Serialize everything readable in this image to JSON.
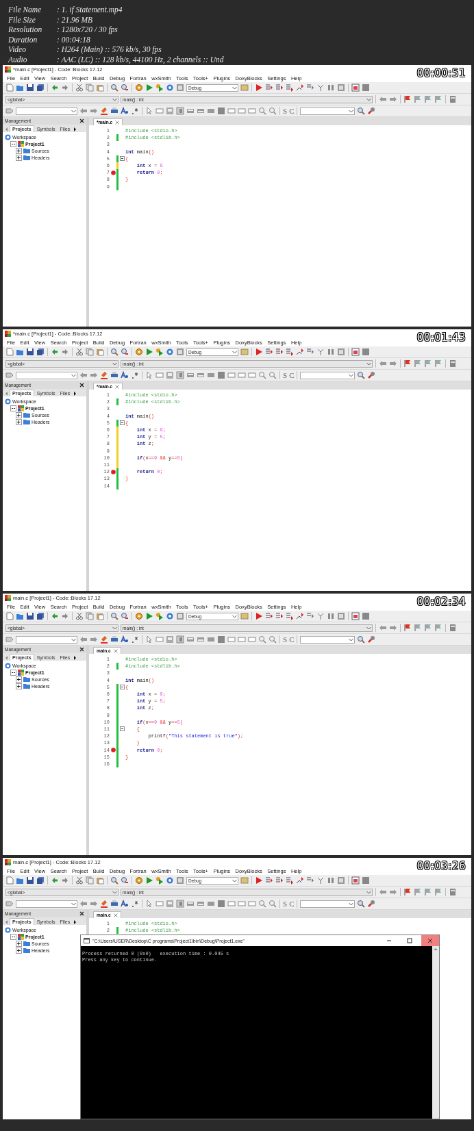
{
  "header": {
    "fields": [
      {
        "label": "File Name",
        "value": ":  1. if Statement.mp4"
      },
      {
        "label": "File Size",
        "value": ":  21.96 MB"
      },
      {
        "label": "Resolution",
        "value": ":  1280x720 / 30 fps"
      },
      {
        "label": "Duration",
        "value": ":  00:04:18"
      },
      {
        "label": "Video",
        "value": ":  H264 (Main) :: 576 kb/s, 30 fps"
      },
      {
        "label": "Audio",
        "value": ":  AAC (LC) :: 128 kb/s, 44100 Hz, 2 channels :: Und"
      }
    ]
  },
  "frames": [
    {
      "title": "*main.c [Project1] - Code::Blocks 17.12",
      "timestamp": "00:00:51",
      "menu": [
        "File",
        "Edit",
        "View",
        "Search",
        "Project",
        "Build",
        "Debug",
        "Fortran",
        "wxSmith",
        "Tools",
        "Tools+",
        "Plugins",
        "DoxyBlocks",
        "Settings",
        "Help"
      ],
      "build_target": "Debug",
      "scope_combo": "<global>",
      "function_combo": "main() : int",
      "toolbar_letters": [
        "S",
        "C"
      ],
      "management": {
        "title": "Management",
        "tabs": [
          {
            "label": "Projects",
            "selected": true
          },
          {
            "label": "Symbols",
            "selected": false
          },
          {
            "label": "Files",
            "selected": false
          }
        ],
        "tree": [
          {
            "label": "Workspace",
            "kind": "workspace",
            "children": [
              {
                "label": "Project1",
                "kind": "project",
                "expanded": true,
                "children": [
                  {
                    "label": "Sources",
                    "kind": "folder",
                    "expanded": false
                  },
                  {
                    "label": "Headers",
                    "kind": "folder",
                    "expanded": false
                  }
                ]
              }
            ]
          }
        ]
      },
      "editor_tab": "*main.c",
      "lines": [
        {
          "number": "1",
          "saved": false,
          "unsaved": false,
          "breakpoint": false,
          "fold": false,
          "tokens": [
            {
              "text": "#include <stdio.h>",
              "kind": "pre"
            }
          ]
        },
        {
          "number": "2",
          "saved": true,
          "unsaved": false,
          "breakpoint": false,
          "fold": false,
          "tokens": [
            {
              "text": "#include <stdlib.h>",
              "kind": "pre"
            }
          ]
        },
        {
          "number": "3",
          "saved": false,
          "unsaved": false,
          "breakpoint": false,
          "fold": false
        },
        {
          "number": "4",
          "saved": false,
          "unsaved": false,
          "breakpoint": false,
          "fold": false,
          "tokens": [
            {
              "text": "int",
              "kind": "kw"
            },
            {
              "text": " main",
              "kind": "plain"
            },
            {
              "text": "()",
              "kind": "op"
            }
          ]
        },
        {
          "number": "5",
          "saved": true,
          "unsaved": false,
          "breakpoint": false,
          "fold": true,
          "tokens": [
            {
              "text": "{",
              "kind": "op"
            }
          ]
        },
        {
          "number": "6",
          "saved": false,
          "unsaved": true,
          "breakpoint": false,
          "fold": false,
          "tokens": [
            {
              "text": "    int",
              "kind": "kw"
            },
            {
              "text": " x ",
              "kind": "plain"
            },
            {
              "text": "=",
              "kind": "op"
            },
            {
              "text": " 9",
              "kind": "num"
            }
          ]
        },
        {
          "number": "7",
          "saved": true,
          "unsaved": false,
          "breakpoint": true,
          "fold": false,
          "tokens": [
            {
              "text": "    return",
              "kind": "kw"
            },
            {
              "text": " 0",
              "kind": "num"
            },
            {
              "text": ";",
              "kind": "op"
            }
          ]
        },
        {
          "number": "8",
          "saved": true,
          "unsaved": false,
          "breakpoint": false,
          "fold": false,
          "tokens": [
            {
              "text": "}",
              "kind": "op"
            }
          ]
        },
        {
          "number": "9",
          "saved": true,
          "unsaved": false,
          "breakpoint": false,
          "fold": false
        }
      ]
    },
    {
      "title": "*main.c [Project1] - Code::Blocks 17.12",
      "timestamp": "00:01:43",
      "menu": [
        "File",
        "Edit",
        "View",
        "Search",
        "Project",
        "Build",
        "Debug",
        "Fortran",
        "wxSmith",
        "Tools",
        "Tools+",
        "Plugins",
        "DoxyBlocks",
        "Settings",
        "Help"
      ],
      "build_target": "Debug",
      "scope_combo": "<global>",
      "function_combo": "main() : int",
      "toolbar_letters": [
        "S",
        "C"
      ],
      "management": {
        "title": "Management",
        "tabs": [
          {
            "label": "Projects",
            "selected": true
          },
          {
            "label": "Symbols",
            "selected": false
          },
          {
            "label": "Files",
            "selected": false
          }
        ],
        "tree": [
          {
            "label": "Workspace",
            "kind": "workspace",
            "children": [
              {
                "label": "Project1",
                "kind": "project",
                "expanded": true,
                "children": [
                  {
                    "label": "Sources",
                    "kind": "folder",
                    "expanded": false
                  },
                  {
                    "label": "Headers",
                    "kind": "folder",
                    "expanded": false
                  }
                ]
              }
            ]
          }
        ]
      },
      "editor_tab": "*main.c",
      "lines": [
        {
          "number": "1",
          "saved": false,
          "unsaved": false,
          "breakpoint": false,
          "fold": false,
          "tokens": [
            {
              "text": "#include <stdio.h>",
              "kind": "pre"
            }
          ]
        },
        {
          "number": "2",
          "saved": true,
          "unsaved": false,
          "breakpoint": false,
          "fold": false,
          "tokens": [
            {
              "text": "#include <stdlib.h>",
              "kind": "pre"
            }
          ]
        },
        {
          "number": "3",
          "saved": false,
          "unsaved": false,
          "breakpoint": false,
          "fold": false
        },
        {
          "number": "4",
          "saved": false,
          "unsaved": false,
          "breakpoint": false,
          "fold": false,
          "tokens": [
            {
              "text": "int",
              "kind": "kw"
            },
            {
              "text": " main",
              "kind": "plain"
            },
            {
              "text": "()",
              "kind": "op"
            }
          ]
        },
        {
          "number": "5",
          "saved": true,
          "unsaved": false,
          "breakpoint": false,
          "fold": true,
          "tokens": [
            {
              "text": "{",
              "kind": "op"
            }
          ]
        },
        {
          "number": "6",
          "saved": false,
          "unsaved": true,
          "breakpoint": false,
          "fold": false,
          "tokens": [
            {
              "text": "    int",
              "kind": "kw"
            },
            {
              "text": " x ",
              "kind": "plain"
            },
            {
              "text": "=",
              "kind": "op"
            },
            {
              "text": " 9",
              "kind": "num"
            },
            {
              "text": ";",
              "kind": "op"
            }
          ]
        },
        {
          "number": "7",
          "saved": false,
          "unsaved": true,
          "breakpoint": false,
          "fold": false,
          "tokens": [
            {
              "text": "    int",
              "kind": "kw"
            },
            {
              "text": " y ",
              "kind": "plain"
            },
            {
              "text": "=",
              "kind": "op"
            },
            {
              "text": " 5",
              "kind": "num"
            },
            {
              "text": ";",
              "kind": "op"
            }
          ]
        },
        {
          "number": "8",
          "saved": false,
          "unsaved": true,
          "breakpoint": false,
          "fold": false,
          "tokens": [
            {
              "text": "    int",
              "kind": "kw"
            },
            {
              "text": " z",
              "kind": "plain"
            },
            {
              "text": ";",
              "kind": "op"
            }
          ]
        },
        {
          "number": "9",
          "saved": false,
          "unsaved": true,
          "breakpoint": false,
          "fold": false
        },
        {
          "number": "10",
          "saved": false,
          "unsaved": true,
          "breakpoint": false,
          "fold": false,
          "tokens": [
            {
              "text": "    if",
              "kind": "kw"
            },
            {
              "text": "(",
              "kind": "op"
            },
            {
              "text": "x",
              "kind": "plain"
            },
            {
              "text": "==",
              "kind": "op"
            },
            {
              "text": "9",
              "kind": "num"
            },
            {
              "text": " && ",
              "kind": "op"
            },
            {
              "text": "y",
              "kind": "plain"
            },
            {
              "text": "==",
              "kind": "op"
            },
            {
              "text": "5",
              "kind": "num"
            },
            {
              "text": ")",
              "kind": "op"
            }
          ]
        },
        {
          "number": "11",
          "saved": false,
          "unsaved": true,
          "breakpoint": false,
          "fold": false
        },
        {
          "number": "12",
          "saved": true,
          "unsaved": false,
          "breakpoint": true,
          "fold": false,
          "tokens": [
            {
              "text": "    return",
              "kind": "kw"
            },
            {
              "text": " 0",
              "kind": "num"
            },
            {
              "text": ";",
              "kind": "op"
            }
          ]
        },
        {
          "number": "13",
          "saved": true,
          "unsaved": false,
          "breakpoint": false,
          "fold": false,
          "tokens": [
            {
              "text": "}",
              "kind": "op"
            }
          ]
        },
        {
          "number": "14",
          "saved": true,
          "unsaved": false,
          "breakpoint": false,
          "fold": false
        }
      ]
    },
    {
      "title": "main.c [Project1] - Code::Blocks 17.12",
      "timestamp": "00:02:34",
      "menu": [
        "File",
        "Edit",
        "View",
        "Search",
        "Project",
        "Build",
        "Debug",
        "Fortran",
        "wxSmith",
        "Tools",
        "Tools+",
        "Plugins",
        "DoxyBlocks",
        "Settings",
        "Help"
      ],
      "build_target": "Debug",
      "scope_combo": "<global>",
      "function_combo": "main() : int",
      "toolbar_letters": [
        "S",
        "C"
      ],
      "management": {
        "title": "Management",
        "tabs": [
          {
            "label": "Projects",
            "selected": true
          },
          {
            "label": "Symbols",
            "selected": false
          },
          {
            "label": "Files",
            "selected": false
          }
        ],
        "tree": [
          {
            "label": "Workspace",
            "kind": "workspace",
            "children": [
              {
                "label": "Project1",
                "kind": "project",
                "expanded": true,
                "children": [
                  {
                    "label": "Sources",
                    "kind": "folder",
                    "expanded": false
                  },
                  {
                    "label": "Headers",
                    "kind": "folder",
                    "expanded": false
                  }
                ]
              }
            ]
          }
        ]
      },
      "editor_tab": "main.c",
      "lines": [
        {
          "number": "1",
          "saved": false,
          "unsaved": false,
          "breakpoint": false,
          "fold": false,
          "tokens": [
            {
              "text": "#include <stdio.h>",
              "kind": "pre"
            }
          ]
        },
        {
          "number": "2",
          "saved": true,
          "unsaved": false,
          "breakpoint": false,
          "fold": false,
          "tokens": [
            {
              "text": "#include <stdlib.h>",
              "kind": "pre"
            }
          ]
        },
        {
          "number": "3",
          "saved": false,
          "unsaved": false,
          "breakpoint": false,
          "fold": false
        },
        {
          "number": "4",
          "saved": false,
          "unsaved": false,
          "breakpoint": false,
          "fold": false,
          "tokens": [
            {
              "text": "int",
              "kind": "kw"
            },
            {
              "text": " main",
              "kind": "plain"
            },
            {
              "text": "()",
              "kind": "op"
            }
          ]
        },
        {
          "number": "5",
          "saved": true,
          "unsaved": false,
          "breakpoint": false,
          "fold": true,
          "tokens": [
            {
              "text": "{",
              "kind": "op"
            }
          ]
        },
        {
          "number": "6",
          "saved": true,
          "unsaved": false,
          "breakpoint": false,
          "fold": false,
          "tokens": [
            {
              "text": "    int",
              "kind": "kw"
            },
            {
              "text": " x ",
              "kind": "plain"
            },
            {
              "text": "=",
              "kind": "op"
            },
            {
              "text": " 9",
              "kind": "num"
            },
            {
              "text": ";",
              "kind": "op"
            }
          ]
        },
        {
          "number": "7",
          "saved": true,
          "unsaved": false,
          "breakpoint": false,
          "fold": false,
          "tokens": [
            {
              "text": "    int",
              "kind": "kw"
            },
            {
              "text": " y ",
              "kind": "plain"
            },
            {
              "text": "=",
              "kind": "op"
            },
            {
              "text": " 5",
              "kind": "num"
            },
            {
              "text": ";",
              "kind": "op"
            }
          ]
        },
        {
          "number": "8",
          "saved": true,
          "unsaved": false,
          "breakpoint": false,
          "fold": false,
          "tokens": [
            {
              "text": "    int",
              "kind": "kw"
            },
            {
              "text": " z",
              "kind": "plain"
            },
            {
              "text": ";",
              "kind": "op"
            }
          ]
        },
        {
          "number": "9",
          "saved": true,
          "unsaved": false,
          "breakpoint": false,
          "fold": false
        },
        {
          "number": "10",
          "saved": true,
          "unsaved": false,
          "breakpoint": false,
          "fold": false,
          "tokens": [
            {
              "text": "    if",
              "kind": "kw"
            },
            {
              "text": "(",
              "kind": "op"
            },
            {
              "text": "x",
              "kind": "plain"
            },
            {
              "text": "==",
              "kind": "op"
            },
            {
              "text": "9",
              "kind": "num"
            },
            {
              "text": " && ",
              "kind": "op"
            },
            {
              "text": "y",
              "kind": "plain"
            },
            {
              "text": "==",
              "kind": "op"
            },
            {
              "text": "5",
              "kind": "num"
            },
            {
              "text": ")",
              "kind": "op"
            }
          ]
        },
        {
          "number": "11",
          "saved": true,
          "unsaved": false,
          "breakpoint": false,
          "fold": true,
          "tokens": [
            {
              "text": "    {",
              "kind": "op"
            }
          ]
        },
        {
          "number": "12",
          "saved": true,
          "unsaved": false,
          "breakpoint": false,
          "fold": false,
          "tokens": [
            {
              "text": "        printf",
              "kind": "plain"
            },
            {
              "text": "(",
              "kind": "op"
            },
            {
              "text": "\"This statement is true\"",
              "kind": "str"
            },
            {
              "text": ");",
              "kind": "op"
            }
          ]
        },
        {
          "number": "13",
          "saved": true,
          "unsaved": false,
          "breakpoint": false,
          "fold": false,
          "tokens": [
            {
              "text": "    }",
              "kind": "op"
            }
          ]
        },
        {
          "number": "14",
          "saved": true,
          "unsaved": false,
          "breakpoint": true,
          "fold": false,
          "tokens": [
            {
              "text": "    return",
              "kind": "kw"
            },
            {
              "text": " 0",
              "kind": "num"
            },
            {
              "text": ";",
              "kind": "op"
            }
          ]
        },
        {
          "number": "15",
          "saved": true,
          "unsaved": false,
          "breakpoint": false,
          "fold": false,
          "tokens": [
            {
              "text": "}",
              "kind": "op"
            }
          ]
        },
        {
          "number": "16",
          "saved": true,
          "unsaved": false,
          "breakpoint": false,
          "fold": false
        }
      ]
    },
    {
      "title": "main.c [Project1] - Code::Blocks 17.12",
      "timestamp": "00:03:26",
      "menu": [
        "File",
        "Edit",
        "View",
        "Search",
        "Project",
        "Build",
        "Debug",
        "Fortran",
        "wxSmith",
        "Tools",
        "Tools+",
        "Plugins",
        "DoxyBlocks",
        "Settings",
        "Help"
      ],
      "build_target": "Debug",
      "scope_combo": "<global>",
      "function_combo": "main() : int",
      "toolbar_letters": [
        "S",
        "C"
      ],
      "management": {
        "title": "Management",
        "tabs": [
          {
            "label": "Projects",
            "selected": true
          },
          {
            "label": "Symbols",
            "selected": false
          },
          {
            "label": "Files",
            "selected": false
          }
        ],
        "tree": [
          {
            "label": "Workspace",
            "kind": "workspace",
            "children": [
              {
                "label": "Project1",
                "kind": "project",
                "expanded": true,
                "children": [
                  {
                    "label": "Sources",
                    "kind": "folder",
                    "expanded": false
                  },
                  {
                    "label": "Headers",
                    "kind": "folder",
                    "expanded": false
                  }
                ]
              }
            ]
          }
        ]
      },
      "editor_tab": "main.c",
      "lines": [
        {
          "number": "1",
          "saved": false,
          "unsaved": false,
          "breakpoint": false,
          "fold": false,
          "tokens": [
            {
              "text": "#include <stdio.h>",
              "kind": "pre"
            }
          ]
        },
        {
          "number": "2",
          "saved": true,
          "unsaved": false,
          "breakpoint": false,
          "fold": false,
          "tokens": [
            {
              "text": "#include <stdlib.h>",
              "kind": "pre"
            }
          ]
        }
      ],
      "console": {
        "title": "\"C:\\Users\\USER\\Desktop\\C programs\\Project1\\bin\\Debug\\Project1.exe\"",
        "close_hovered": true,
        "output": [
          "Process returned 0 (0x0)   execution time : 0.045 s",
          "Press any key to continue."
        ]
      }
    }
  ]
}
